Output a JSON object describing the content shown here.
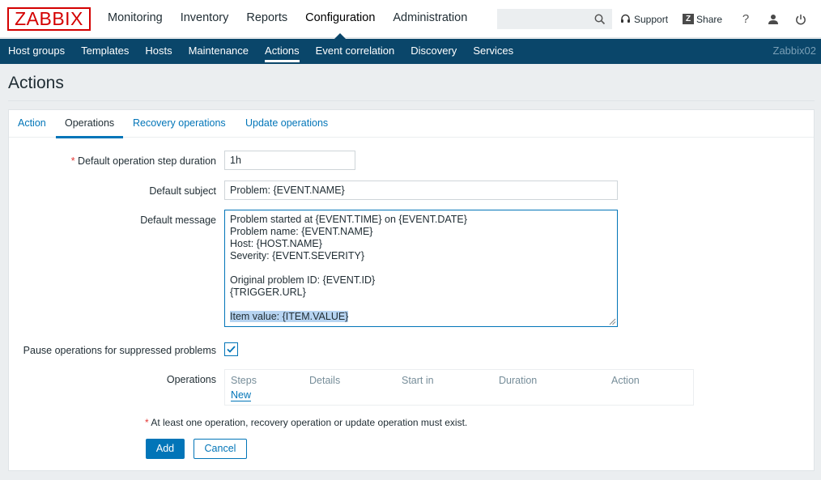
{
  "logo": "ZABBIX",
  "top_nav": [
    {
      "label": "Monitoring"
    },
    {
      "label": "Inventory"
    },
    {
      "label": "Reports"
    },
    {
      "label": "Configuration",
      "selected": true
    },
    {
      "label": "Administration"
    }
  ],
  "top_links": {
    "support": "Support",
    "share": "Share",
    "share_badge": "Z",
    "help": "?"
  },
  "sub_nav": [
    {
      "label": "Host groups"
    },
    {
      "label": "Templates"
    },
    {
      "label": "Hosts"
    },
    {
      "label": "Maintenance"
    },
    {
      "label": "Actions",
      "selected": true
    },
    {
      "label": "Event correlation"
    },
    {
      "label": "Discovery"
    },
    {
      "label": "Services"
    }
  ],
  "server_name": "Zabbix02",
  "page_title": "Actions",
  "tabs": [
    {
      "label": "Action"
    },
    {
      "label": "Operations",
      "active": true
    },
    {
      "label": "Recovery operations"
    },
    {
      "label": "Update operations"
    }
  ],
  "form": {
    "step_duration_label": "Default operation step duration",
    "step_duration_value": "1h",
    "subject_label": "Default subject",
    "subject_value": "Problem: {EVENT.NAME}",
    "message_label": "Default message",
    "message_lines": [
      "Problem started at {EVENT.TIME} on {EVENT.DATE}",
      "Problem name: {EVENT.NAME}",
      "Host: {HOST.NAME}",
      "Severity: {EVENT.SEVERITY}",
      "",
      "Original problem ID: {EVENT.ID}",
      "{TRIGGER.URL}",
      "",
      "Item value: {ITEM.VALUE}"
    ],
    "pause_label": "Pause operations for suppressed problems",
    "pause_checked": true,
    "operations_label": "Operations",
    "operations_columns": [
      "Steps",
      "Details",
      "Start in",
      "Duration",
      "Action"
    ],
    "new_link": "New",
    "note": "At least one operation, recovery operation or update operation must exist.",
    "required_marker": "*",
    "add_button": "Add",
    "cancel_button": "Cancel"
  },
  "colors": {
    "brand": "#d40000",
    "nav_bg": "#0a466a",
    "link": "#0275b8",
    "required": "#e33734"
  }
}
